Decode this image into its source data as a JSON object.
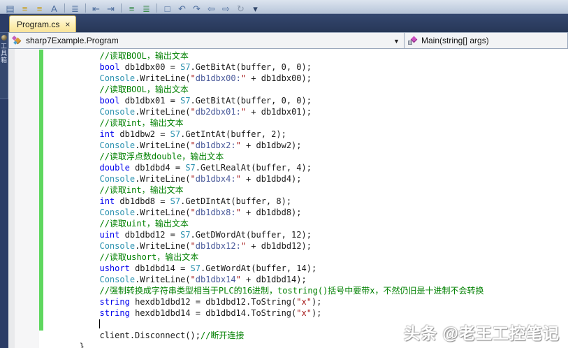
{
  "toolbar": {
    "items": [
      {
        "name": "properties-window-icon",
        "glyph": "▤",
        "color": "#4e6e9e"
      },
      {
        "name": "bookmark-prev-icon",
        "glyph": "≡",
        "color": "#c9a227"
      },
      {
        "name": "bookmark-next-icon",
        "glyph": "≡",
        "color": "#c9a227"
      },
      {
        "name": "font-case-icon",
        "glyph": "A",
        "color": "#4e6e9e"
      },
      {
        "sep": true
      },
      {
        "name": "show-whitespace-icon",
        "glyph": "≣",
        "color": "#4e6e9e"
      },
      {
        "sep": true
      },
      {
        "name": "outdent-icon",
        "glyph": "⇤",
        "color": "#4e6e9e"
      },
      {
        "name": "indent-icon",
        "glyph": "⇥",
        "color": "#4e6e9e"
      },
      {
        "sep": true
      },
      {
        "name": "comment-selection-icon",
        "glyph": "≡",
        "color": "#3e8e4e"
      },
      {
        "name": "uncomment-selection-icon",
        "glyph": "≣",
        "color": "#3e8e4e"
      },
      {
        "sep": true
      },
      {
        "name": "new-window-icon",
        "glyph": "□",
        "color": "#4e6e9e"
      },
      {
        "name": "nav-back-icon",
        "glyph": "↶",
        "color": "#4e6e9e"
      },
      {
        "name": "nav-forward-icon",
        "glyph": "↷",
        "color": "#4e6e9e"
      },
      {
        "name": "frame-back-icon",
        "glyph": "⇦",
        "color": "#4e6e9e"
      },
      {
        "name": "frame-forward-icon",
        "glyph": "⇨",
        "color": "#4e6e9e"
      },
      {
        "name": "find-symbol-icon",
        "glyph": "↻",
        "color": "#8a98ac"
      },
      {
        "name": "toolbar-overflow-icon",
        "glyph": "▾",
        "color": "#2f4468"
      }
    ]
  },
  "toolbox_tab": {
    "label": "工具箱"
  },
  "tab": {
    "label": "Program.cs",
    "close": "×"
  },
  "navbar": {
    "type_combo": {
      "text": "sharp7Example.Program",
      "arrow": "▼"
    },
    "member_combo": {
      "text": "Main(string[] args)"
    }
  },
  "watermark": {
    "text": "头条 @老王工控笔记"
  },
  "colors": {
    "comment": "#008000",
    "keyword": "#0000ee",
    "type_name": "#2b91af",
    "plain": "#1a1a1a",
    "string_quote": "#a31515",
    "string_content": "#4a5a9a",
    "change_bar": "#5fd75f",
    "tab_active": "#fdeeb0",
    "frame": "#2b3c66"
  },
  "code": {
    "indent": "           ",
    "lines": [
      {
        "segs": [
          {
            "t": "           //读取BOOL，输出文本",
            "c": "cm"
          }
        ]
      },
      {
        "segs": [
          {
            "t": "           ",
            "c": "pl"
          },
          {
            "t": "bool",
            "c": "kw"
          },
          {
            "t": " db1dbx00 = ",
            "c": "pl"
          },
          {
            "t": "S7",
            "c": "ty"
          },
          {
            "t": ".GetBitAt(buffer, 0, 0);",
            "c": "pl"
          }
        ]
      },
      {
        "segs": [
          {
            "t": "           ",
            "c": "pl"
          },
          {
            "t": "Console",
            "c": "ty"
          },
          {
            "t": ".WriteLine(",
            "c": "pl"
          },
          {
            "t": "\"",
            "c": "st"
          },
          {
            "t": "db1dbx00:",
            "c": "sv"
          },
          {
            "t": "\"",
            "c": "st"
          },
          {
            "t": " + db1dbx00);",
            "c": "pl"
          }
        ]
      },
      {
        "segs": [
          {
            "t": "           //读取BOOL，输出文本",
            "c": "cm"
          }
        ]
      },
      {
        "segs": [
          {
            "t": "           ",
            "c": "pl"
          },
          {
            "t": "bool",
            "c": "kw"
          },
          {
            "t": " db1dbx01 = ",
            "c": "pl"
          },
          {
            "t": "S7",
            "c": "ty"
          },
          {
            "t": ".GetBitAt(buffer, 0, 0);",
            "c": "pl"
          }
        ]
      },
      {
        "segs": [
          {
            "t": "           ",
            "c": "pl"
          },
          {
            "t": "Console",
            "c": "ty"
          },
          {
            "t": ".WriteLine(",
            "c": "pl"
          },
          {
            "t": "\"",
            "c": "st"
          },
          {
            "t": "db2dbx01:",
            "c": "sv"
          },
          {
            "t": "\"",
            "c": "st"
          },
          {
            "t": " + db1dbx01);",
            "c": "pl"
          }
        ]
      },
      {
        "segs": [
          {
            "t": "           //读取int，输出文本",
            "c": "cm"
          }
        ]
      },
      {
        "segs": [
          {
            "t": "           ",
            "c": "pl"
          },
          {
            "t": "int",
            "c": "kw"
          },
          {
            "t": " db1dbw2 = ",
            "c": "pl"
          },
          {
            "t": "S7",
            "c": "ty"
          },
          {
            "t": ".GetIntAt(buffer, 2);",
            "c": "pl"
          }
        ]
      },
      {
        "segs": [
          {
            "t": "           ",
            "c": "pl"
          },
          {
            "t": "Console",
            "c": "ty"
          },
          {
            "t": ".WriteLine(",
            "c": "pl"
          },
          {
            "t": "\"",
            "c": "st"
          },
          {
            "t": "db1dbx2:",
            "c": "sv"
          },
          {
            "t": "\"",
            "c": "st"
          },
          {
            "t": " + db1dbw2);",
            "c": "pl"
          }
        ]
      },
      {
        "segs": [
          {
            "t": "           //读取浮点数double，输出文本",
            "c": "cm"
          }
        ]
      },
      {
        "segs": [
          {
            "t": "           ",
            "c": "pl"
          },
          {
            "t": "double",
            "c": "kw"
          },
          {
            "t": " db1dbd4 = ",
            "c": "pl"
          },
          {
            "t": "S7",
            "c": "ty"
          },
          {
            "t": ".GetLRealAt(buffer, 4);",
            "c": "pl"
          }
        ]
      },
      {
        "segs": [
          {
            "t": "           ",
            "c": "pl"
          },
          {
            "t": "Console",
            "c": "ty"
          },
          {
            "t": ".WriteLine(",
            "c": "pl"
          },
          {
            "t": "\"",
            "c": "st"
          },
          {
            "t": "db1dbx4:",
            "c": "sv"
          },
          {
            "t": "\"",
            "c": "st"
          },
          {
            "t": " + db1dbd4);",
            "c": "pl"
          }
        ]
      },
      {
        "segs": [
          {
            "t": "           //读取int，输出文本",
            "c": "cm"
          }
        ]
      },
      {
        "segs": [
          {
            "t": "           ",
            "c": "pl"
          },
          {
            "t": "int",
            "c": "kw"
          },
          {
            "t": " db1dbd8 = ",
            "c": "pl"
          },
          {
            "t": "S7",
            "c": "ty"
          },
          {
            "t": ".GetDIntAt(buffer, 8);",
            "c": "pl"
          }
        ]
      },
      {
        "segs": [
          {
            "t": "           ",
            "c": "pl"
          },
          {
            "t": "Console",
            "c": "ty"
          },
          {
            "t": ".WriteLine(",
            "c": "pl"
          },
          {
            "t": "\"",
            "c": "st"
          },
          {
            "t": "db1dbx8:",
            "c": "sv"
          },
          {
            "t": "\"",
            "c": "st"
          },
          {
            "t": " + db1dbd8);",
            "c": "pl"
          }
        ]
      },
      {
        "segs": [
          {
            "t": "           //读取uint，输出文本",
            "c": "cm"
          }
        ]
      },
      {
        "segs": [
          {
            "t": "           ",
            "c": "pl"
          },
          {
            "t": "uint",
            "c": "kw"
          },
          {
            "t": " db1dbd12 = ",
            "c": "pl"
          },
          {
            "t": "S7",
            "c": "ty"
          },
          {
            "t": ".GetDWordAt(buffer, 12);",
            "c": "pl"
          }
        ]
      },
      {
        "segs": [
          {
            "t": "           ",
            "c": "pl"
          },
          {
            "t": "Console",
            "c": "ty"
          },
          {
            "t": ".WriteLine(",
            "c": "pl"
          },
          {
            "t": "\"",
            "c": "st"
          },
          {
            "t": "db1dbx12:",
            "c": "sv"
          },
          {
            "t": "\"",
            "c": "st"
          },
          {
            "t": " + db1dbd12);",
            "c": "pl"
          }
        ]
      },
      {
        "segs": [
          {
            "t": "           //读取ushort，输出文本",
            "c": "cm"
          }
        ]
      },
      {
        "segs": [
          {
            "t": "           ",
            "c": "pl"
          },
          {
            "t": "ushort",
            "c": "kw"
          },
          {
            "t": " db1dbd14 = ",
            "c": "pl"
          },
          {
            "t": "S7",
            "c": "ty"
          },
          {
            "t": ".GetWordAt(buffer, 14);",
            "c": "pl"
          }
        ]
      },
      {
        "segs": [
          {
            "t": "           ",
            "c": "pl"
          },
          {
            "t": "Console",
            "c": "ty"
          },
          {
            "t": ".WriteLine(",
            "c": "pl"
          },
          {
            "t": "\"",
            "c": "st"
          },
          {
            "t": "db1dbx14",
            "c": "sv"
          },
          {
            "t": "\"",
            "c": "st"
          },
          {
            "t": " + db1dbd14);",
            "c": "pl"
          }
        ]
      },
      {
        "segs": [
          {
            "t": "           //强制转换成字符串类型相当于PLC的16进制，tostring()括号中要带x，不然仍旧是十进制不会转换",
            "c": "cm"
          }
        ]
      },
      {
        "segs": [
          {
            "t": "           ",
            "c": "pl"
          },
          {
            "t": "string",
            "c": "kw"
          },
          {
            "t": " hexdb1dbd12 = db1dbd12.ToString(",
            "c": "pl"
          },
          {
            "t": "\"x\"",
            "c": "st"
          },
          {
            "t": ");",
            "c": "pl"
          }
        ]
      },
      {
        "segs": [
          {
            "t": "           ",
            "c": "pl"
          },
          {
            "t": "string",
            "c": "kw"
          },
          {
            "t": " hexdb1dbd14 = db1dbd14.ToString(",
            "c": "pl"
          },
          {
            "t": "\"x\"",
            "c": "st"
          },
          {
            "t": ");",
            "c": "pl"
          }
        ]
      },
      {
        "caret": true,
        "segs": [
          {
            "t": "           ",
            "c": "pl"
          }
        ]
      },
      {
        "segs": [
          {
            "t": "           client.Disconnect();",
            "c": "pl"
          },
          {
            "t": "//断开连接",
            "c": "cm"
          }
        ]
      },
      {
        "segs": [
          {
            "t": "       }",
            "c": "pl"
          }
        ]
      }
    ]
  }
}
